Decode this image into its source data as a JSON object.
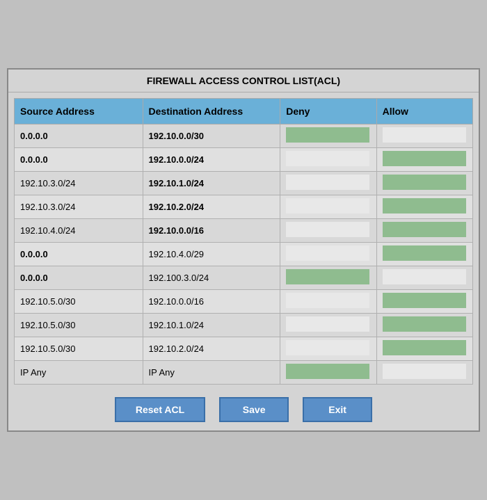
{
  "title": "FIREWALL ACCESS CONTROL LIST(ACL)",
  "columns": {
    "source": "Source Address",
    "destination": "Destination Address",
    "deny": "Deny",
    "allow": "Allow"
  },
  "rows": [
    {
      "source": "0.0.0.0",
      "source_bold": true,
      "dest": "192.10.0.0/30",
      "dest_bold": true,
      "deny": "green",
      "allow": "light"
    },
    {
      "source": "0.0.0.0",
      "source_bold": true,
      "dest": "192.10.0.0/24",
      "dest_bold": true,
      "deny": "light",
      "allow": "green"
    },
    {
      "source": "192.10.3.0/24",
      "source_bold": false,
      "dest": "192.10.1.0/24",
      "dest_bold": true,
      "deny": "light",
      "allow": "green"
    },
    {
      "source": "192.10.3.0/24",
      "source_bold": false,
      "dest": "192.10.2.0/24",
      "dest_bold": true,
      "deny": "light",
      "allow": "green"
    },
    {
      "source": "192.10.4.0/24",
      "source_bold": false,
      "dest": "192.10.0.0/16",
      "dest_bold": true,
      "deny": "light",
      "allow": "green"
    },
    {
      "source": "0.0.0.0",
      "source_bold": true,
      "dest": "192.10.4.0/29",
      "dest_bold": false,
      "deny": "light",
      "allow": "green"
    },
    {
      "source": "0.0.0.0",
      "source_bold": true,
      "dest": "192.100.3.0/24",
      "dest_bold": false,
      "deny": "green",
      "allow": "light"
    },
    {
      "source": "192.10.5.0/30",
      "source_bold": false,
      "dest": "192.10.0.0/16",
      "dest_bold": false,
      "deny": "light",
      "allow": "green"
    },
    {
      "source": "192.10.5.0/30",
      "source_bold": false,
      "dest": "192.10.1.0/24",
      "dest_bold": false,
      "deny": "light",
      "allow": "green"
    },
    {
      "source": "192.10.5.0/30",
      "source_bold": false,
      "dest": "192.10.2.0/24",
      "dest_bold": false,
      "deny": "light",
      "allow": "green"
    },
    {
      "source": "IP Any",
      "source_bold": false,
      "dest": "IP Any",
      "dest_bold": false,
      "deny": "green",
      "allow": "light"
    }
  ],
  "buttons": {
    "reset": "Reset ACL",
    "save": "Save",
    "exit": "Exit"
  }
}
